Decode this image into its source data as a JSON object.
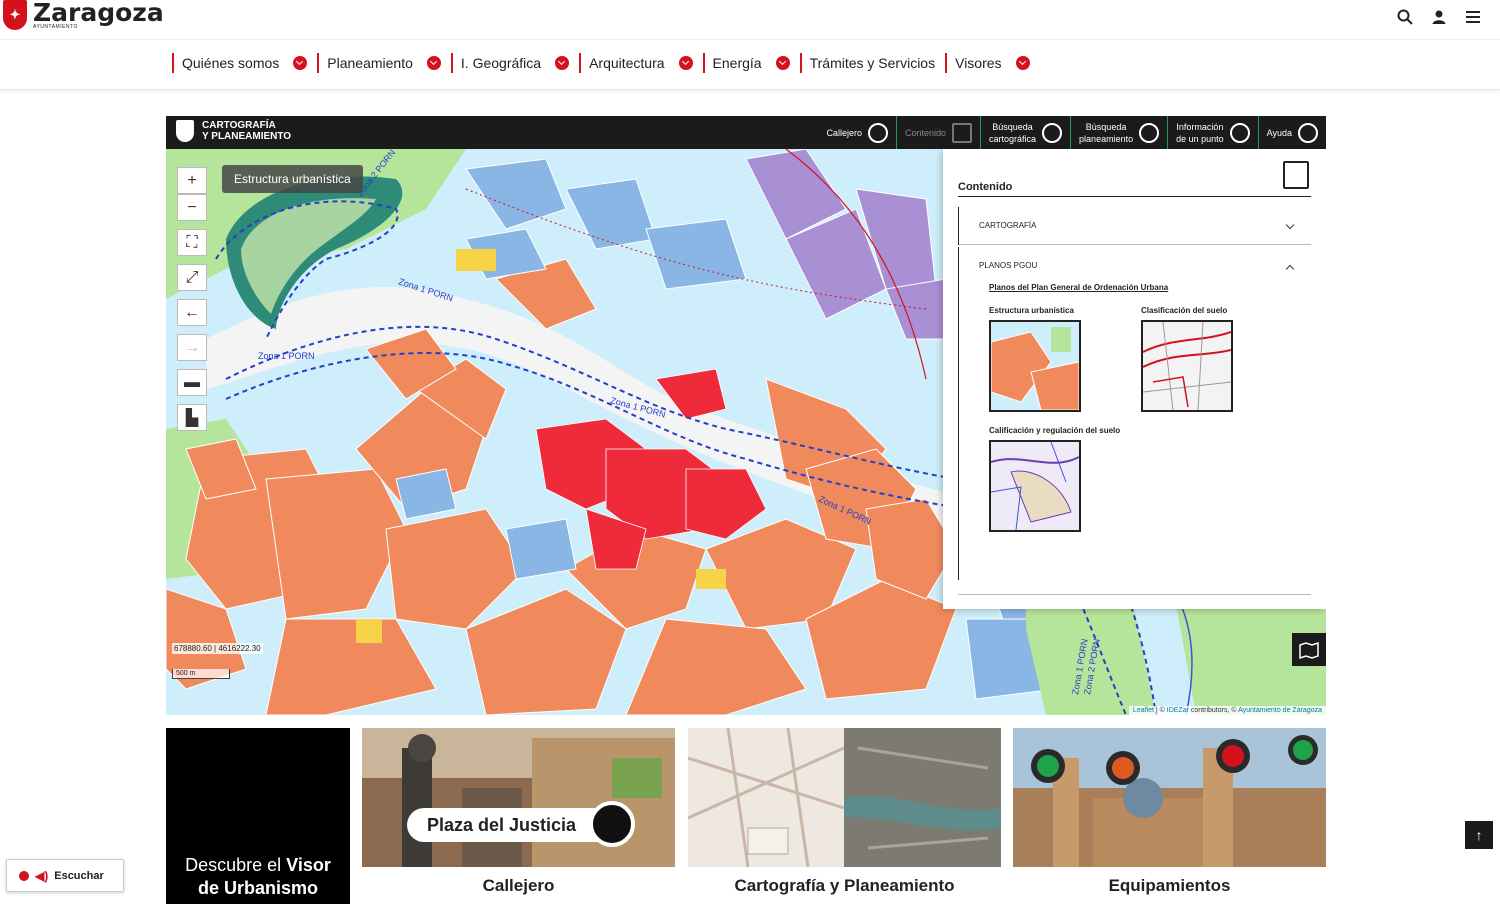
{
  "site": {
    "name": "Zaragoza",
    "sub": "AYUNTAMIENTO",
    "icons": [
      "search-icon",
      "user-icon",
      "menu-icon"
    ]
  },
  "nav": {
    "items": [
      {
        "label": "Quiénes somos"
      },
      {
        "label": "Planeamiento"
      },
      {
        "label": "I. Geográfica"
      },
      {
        "label": "Arquitectura"
      },
      {
        "label": "Energía"
      },
      {
        "label": "Trámites y Servicios"
      },
      {
        "label": "Visores"
      }
    ]
  },
  "viewer": {
    "brand": "CARTOGRAFÍA\nY PLANEAMIENTO",
    "tools": [
      {
        "label": "Callejero",
        "icon": "magnifier-icon"
      },
      {
        "label": "Contenido",
        "icon": "book-map-icon"
      },
      {
        "label": "Búsqueda\ncartográfica",
        "icon": "map-pin-icon"
      },
      {
        "label": "Búsqueda\nplaneamiento",
        "icon": "map-pin-icon"
      },
      {
        "label": "Información\nde un punto",
        "icon": "info-pin-icon"
      },
      {
        "label": "Ayuda",
        "icon": "help-icon"
      }
    ],
    "layer_label": "Estructura urbanística",
    "map_labels": {
      "zona2_top": "Zona 2 PORN",
      "zona1_a": "Zona 1 PORN",
      "zona1_b": "Zona 1 PORN",
      "zona1_c": "Zona 1 PORN",
      "zona1_d": "Zona 1 PORN",
      "zona1_e": "Zona 1 PORN",
      "zona2_bottom": "Zona 2 PORN"
    },
    "coords": "678880.60 | 4616222.30",
    "scale": "500 m",
    "attribution": {
      "leaflet": "Leaflet",
      "mid": " | © ",
      "idezar": "IDEZar",
      "contrib": " contributors, © ",
      "ayto": "Ayuntamiento de Zaragoza"
    }
  },
  "panel": {
    "title": "Contenido",
    "sections": [
      {
        "label": "CARTOGRAFÍA"
      },
      {
        "label": "PLANOS PGOU"
      }
    ],
    "plan_link": "Planos del Plan General de Ordenación Urbana",
    "thumbs": [
      {
        "label": "Estructura urbanística"
      },
      {
        "label": "Clasificación del suelo"
      },
      {
        "label": "Calificación y regulación del suelo"
      }
    ]
  },
  "cards": {
    "promo_prefix": "Descubre el ",
    "promo_bold1": "Visor",
    "promo_line2": "de Urbanismo",
    "callejero_pill": "Plaza del Justicia",
    "items": [
      {
        "title": "Callejero"
      },
      {
        "title": "Cartografía y Planeamiento"
      },
      {
        "title": "Equipamientos"
      }
    ]
  },
  "listen": {
    "label": "Escuchar"
  },
  "colors": {
    "brand_red": "#d4121e",
    "viewer_dark": "#1b1b1b",
    "tool_divider": "#19a04a",
    "residential_orange": "#f08a5d",
    "center_red": "#ee2a3b",
    "park_green": "#b5e59a",
    "equip_blue": "#b7e0f3",
    "industrial_purple": "#a98fd3"
  }
}
